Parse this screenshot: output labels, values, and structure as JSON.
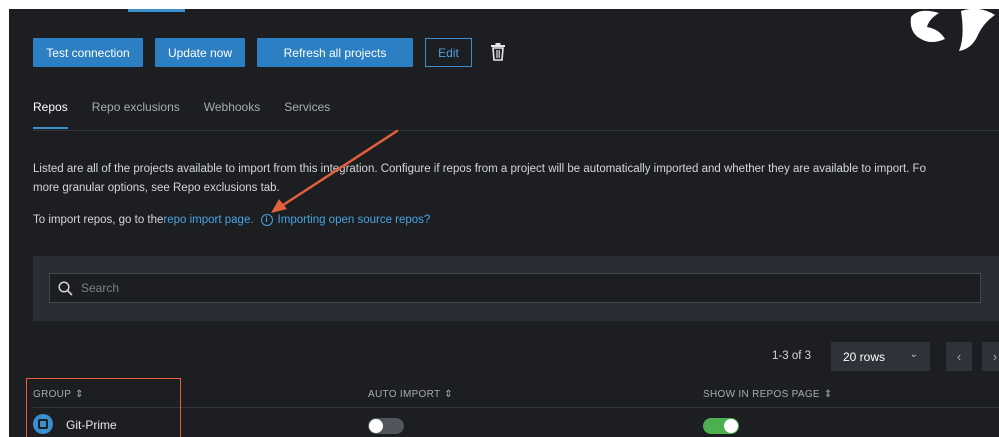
{
  "toolbar": {
    "test_connection": "Test connection",
    "update_now": "Update now",
    "refresh_all": "Refresh all projects",
    "edit": "Edit"
  },
  "tabs": [
    {
      "label": "Repos",
      "active": true
    },
    {
      "label": "Repo exclusions",
      "active": false
    },
    {
      "label": "Webhooks",
      "active": false
    },
    {
      "label": "Services",
      "active": false
    }
  ],
  "description": {
    "line1": "Listed are all of the projects available to import from this integration. Configure if repos from a project will be automatically imported and whether they are available to import. Fo",
    "line2": "more granular options, see Repo exclusions tab.",
    "import_prefix": "To import repos, go to the ",
    "import_link": "repo import page.",
    "open_source_link": "Importing open source repos?"
  },
  "search": {
    "placeholder": "Search"
  },
  "pagination": {
    "count": "1-3 of 3",
    "rows": "20 rows",
    "prev": "‹",
    "next": "›"
  },
  "table": {
    "columns": [
      "GROUP",
      "AUTO IMPORT",
      "SHOW IN REPOS PAGE"
    ],
    "rows": [
      {
        "group": "Git-Prime",
        "auto_import": false,
        "show_in_repos_page": true
      }
    ]
  },
  "colors": {
    "primary": "#2b7fc2",
    "link": "#4aa3e0",
    "background": "#1c1e22",
    "annotation": "#e2603b",
    "toggle_on": "#4caf50"
  },
  "icons": [
    "trash-icon",
    "search-icon",
    "info-icon",
    "chevron-down-icon",
    "sort-icon",
    "repo-group-icon"
  ]
}
